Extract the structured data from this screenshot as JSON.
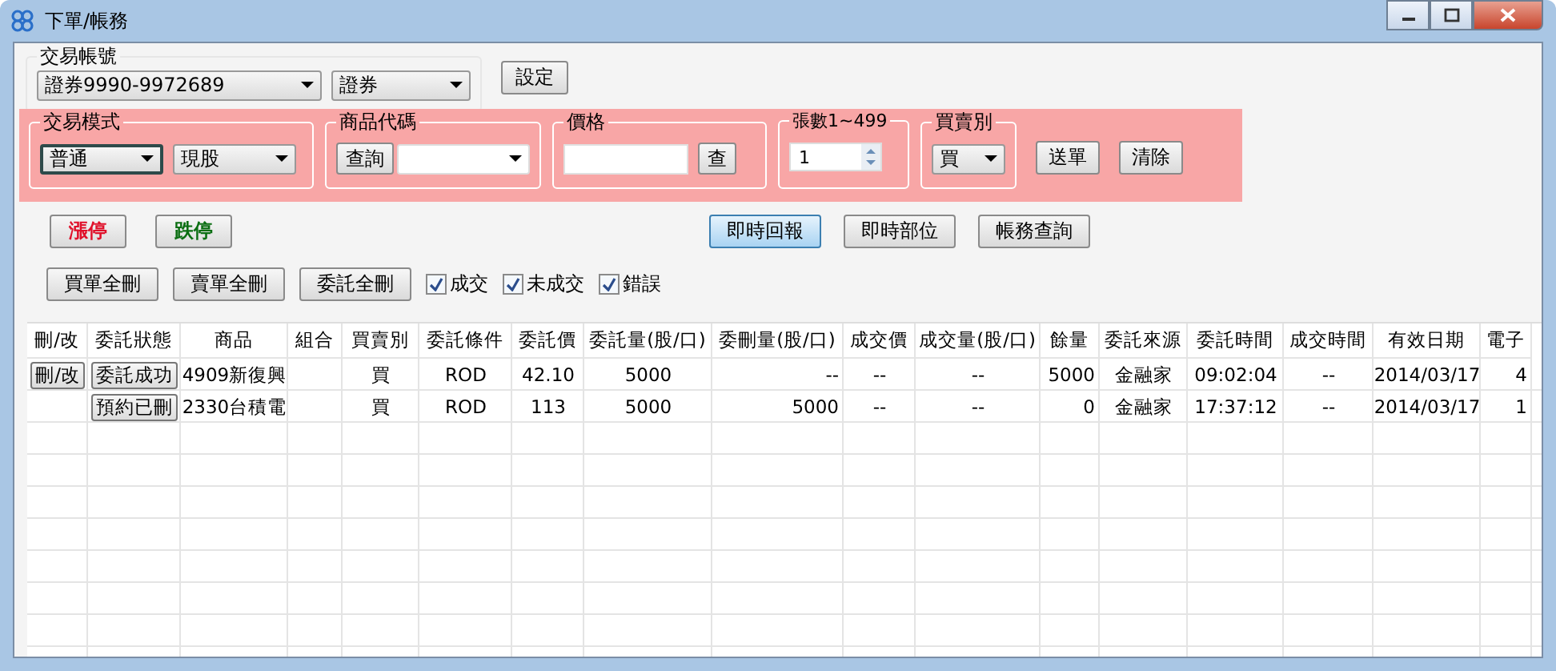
{
  "window": {
    "title": "下單/帳務"
  },
  "account": {
    "label": "交易帳號",
    "account_select": "證券9990-9972689",
    "type_select": "證券",
    "set_button": "設定"
  },
  "order_panel": {
    "trade_mode": {
      "label": "交易模式",
      "mode": "普通",
      "stock_type": "現股"
    },
    "product": {
      "label": "商品代碼",
      "query_button": "查詢"
    },
    "price": {
      "label": "價格",
      "lookup_button": "查"
    },
    "quantity": {
      "label": "張數1~499",
      "value": "1"
    },
    "side": {
      "label": "買賣別",
      "value": "買"
    },
    "buttons": [
      "送單",
      "清除"
    ]
  },
  "limit_buttons": [
    {
      "label": "漲停",
      "kind": "limit_up"
    },
    {
      "label": "跌停",
      "kind": "limit_down"
    }
  ],
  "view_buttons": [
    {
      "label": "即時回報",
      "selected": true
    },
    {
      "label": "即時部位",
      "selected": false
    },
    {
      "label": "帳務查詢",
      "selected": false
    }
  ],
  "bulk_buttons": [
    "買單全刪",
    "賣單全刪",
    "委託全刪"
  ],
  "filters": [
    {
      "label": "成交",
      "checked": true
    },
    {
      "label": "未成交",
      "checked": true
    },
    {
      "label": "錯誤",
      "checked": true
    }
  ],
  "table": {
    "columns": [
      "刪/改",
      "委託狀態",
      "商品",
      "組合",
      "買賣別",
      "委託條件",
      "委託價",
      "委託量(股/口)",
      "委刪量(股/口)",
      "成交價",
      "成交量(股/口)",
      "餘量",
      "委託來源",
      "委託時間",
      "成交時間",
      "有效日期",
      "電子"
    ],
    "rows": [
      {
        "cells": [
          "刪/改",
          "委託成功",
          "4909新復興",
          "",
          "買",
          "ROD",
          "42.10",
          "5000",
          "--",
          "--",
          "--",
          "5000",
          "金融家",
          "09:02:04",
          "--",
          "2014/03/17",
          "4"
        ]
      },
      {
        "cells": [
          "",
          "預約已刪",
          "2330台積電",
          "",
          "買",
          "ROD",
          "113",
          "5000",
          "5000",
          "--",
          "--",
          "0",
          "金融家",
          "17:37:12",
          "--",
          "2014/03/17",
          "1"
        ]
      }
    ]
  }
}
